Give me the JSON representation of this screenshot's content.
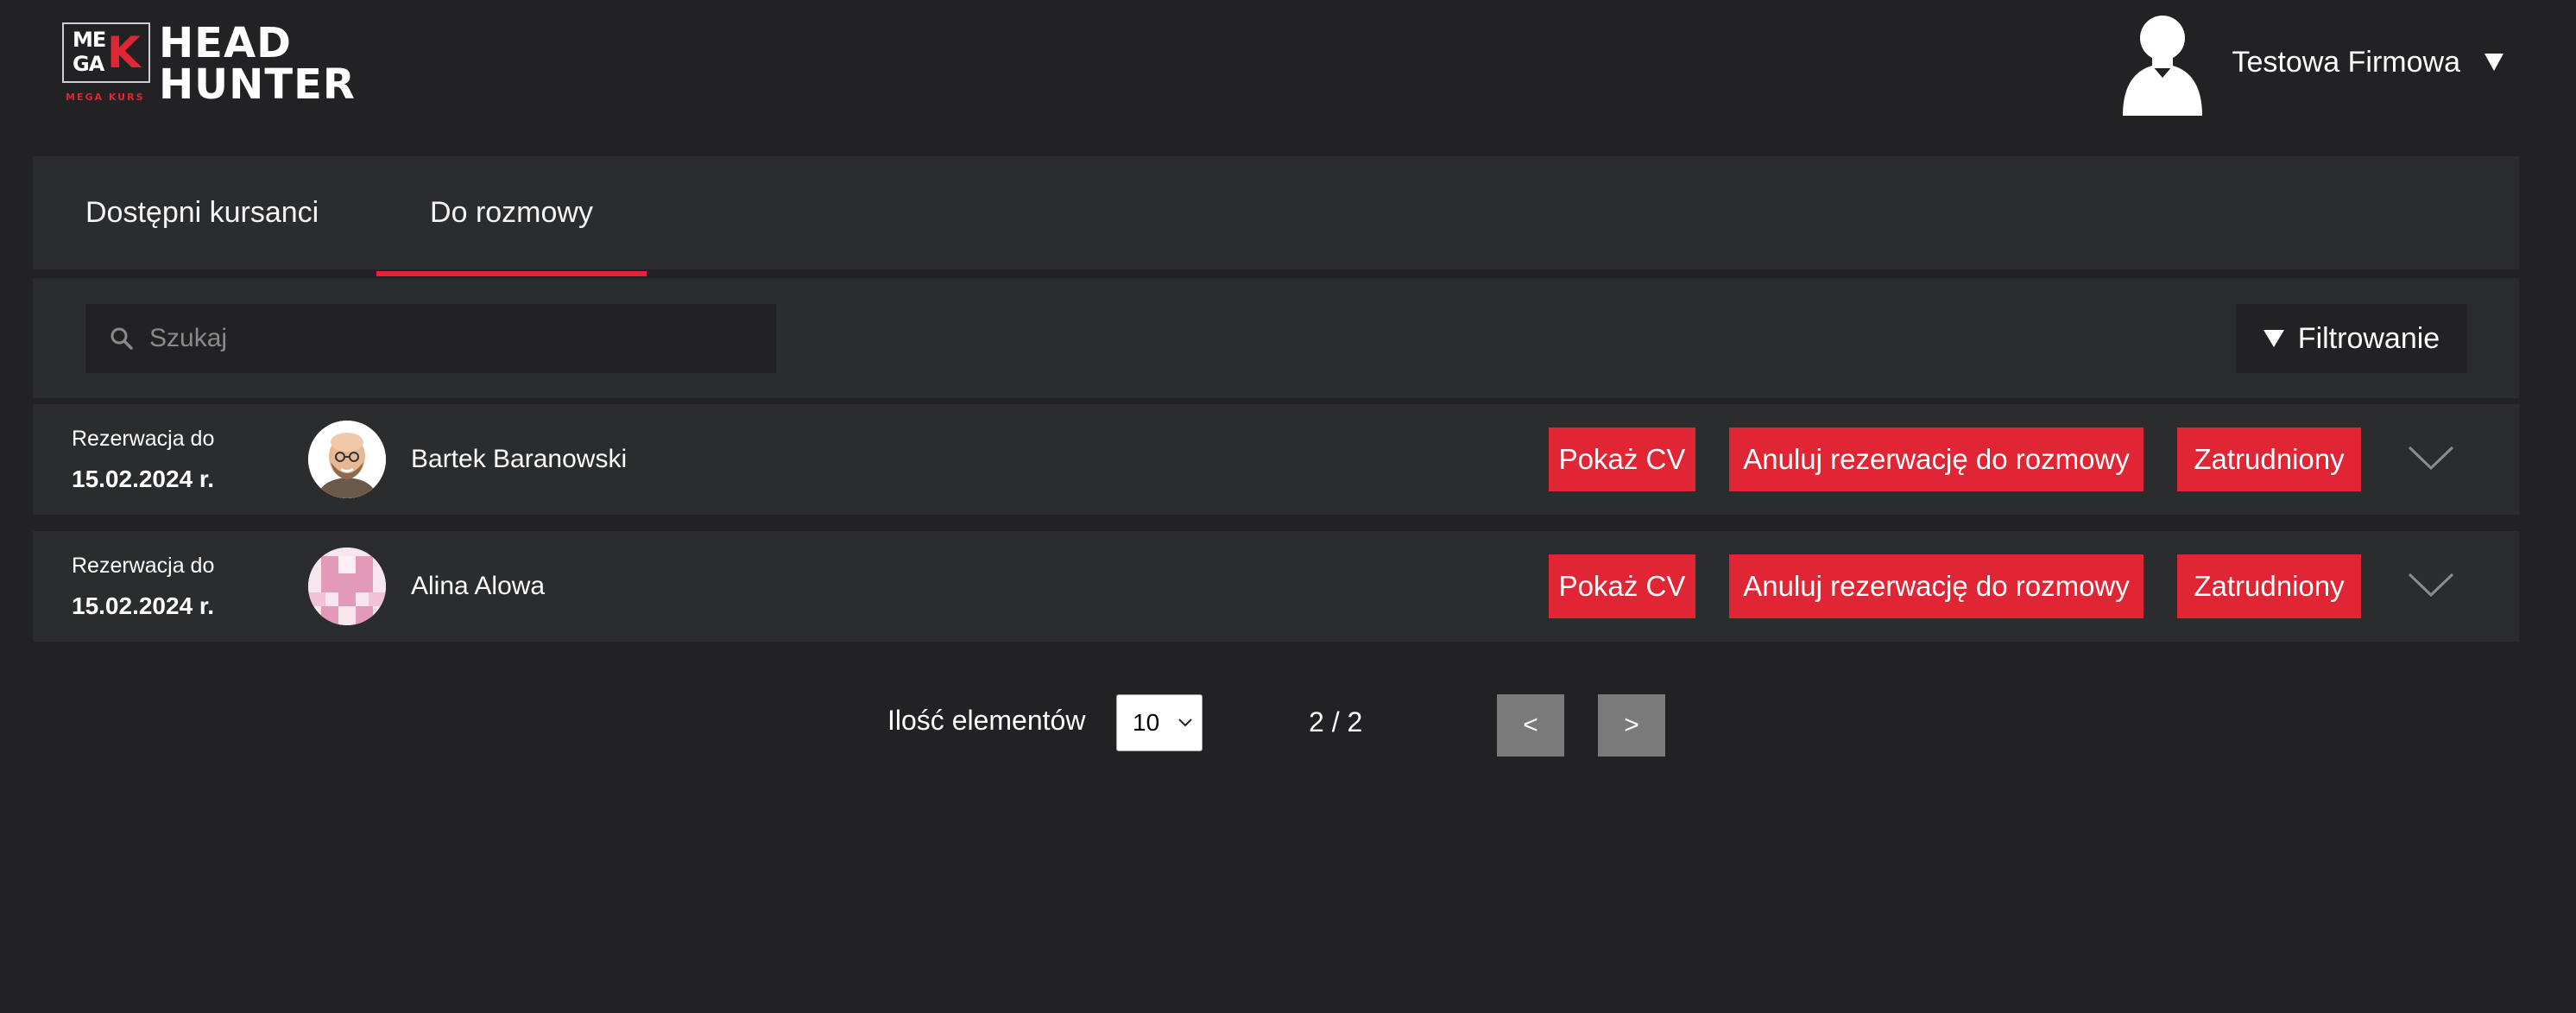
{
  "brand": {
    "logo_line1": "ME",
    "logo_line2": "GA",
    "logo_k": "K",
    "logo_sub": "MEGA KURS",
    "title_line1": "HEAD",
    "title_line2": "HUNTER"
  },
  "user": {
    "name": "Testowa Firmowa",
    "icon": "user-silhouette-icon"
  },
  "tabs": [
    {
      "label": "Dostępni kursanci",
      "active": false
    },
    {
      "label": "Do rozmowy",
      "active": true
    }
  ],
  "colors": {
    "accent": "#e02535",
    "background": "#222224",
    "panel": "#2b2c2e",
    "pager_button": "#7a7a7a"
  },
  "search": {
    "placeholder": "Szukaj",
    "value": "",
    "icon": "search-icon"
  },
  "filter": {
    "label": "Filtrowanie",
    "icon": "triangle-down-icon"
  },
  "candidates": [
    {
      "reservation_label": "Rezerwacja do",
      "reservation_date": "15.02.2024 r.",
      "name": "Bartek Baranowski",
      "avatar": "cartoon-man-avatar",
      "show_cv": "Pokaż CV",
      "cancel": "Anuluj rezerwację do rozmowy",
      "hired": "Zatrudniony",
      "expand_icon": "chevron-down-icon"
    },
    {
      "reservation_label": "Rezerwacja do",
      "reservation_date": "15.02.2024 r.",
      "name": "Alina Alowa",
      "avatar": "pink-identicon-avatar",
      "show_cv": "Pokaż CV",
      "cancel": "Anuluj rezerwację do rozmowy",
      "hired": "Zatrudniony",
      "expand_icon": "chevron-down-icon"
    }
  ],
  "pagination": {
    "items_label": "Ilość elementów",
    "per_page": "10",
    "page_info": "2 / 2",
    "prev": "<",
    "next": ">"
  }
}
